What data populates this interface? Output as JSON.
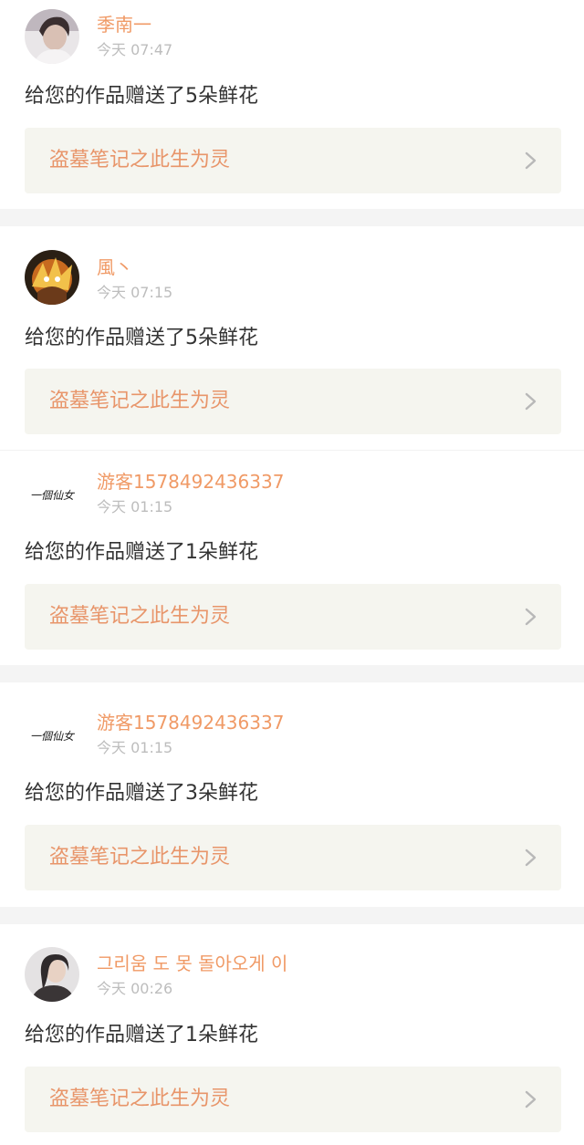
{
  "colors": {
    "accent": "#f09a66",
    "work_title": "#e8956a",
    "card_bg": "#f5f5ef",
    "muted": "#bdbdbd",
    "text": "#333333"
  },
  "notifications": [
    {
      "username": "季南一",
      "time": "今天 07:47",
      "message": "给您的作品赠送了5朵鲜花",
      "work_title": "盗墓笔记之此生为灵",
      "avatar_icon": "user-photo-icon"
    },
    {
      "username": "風丶",
      "time": "今天 07:15",
      "message": "给您的作品赠送了5朵鲜花",
      "work_title": "盗墓笔记之此生为灵",
      "avatar_icon": "anime-character-icon"
    },
    {
      "username": "游客1578492436337",
      "time": "今天 01:15",
      "message": "给您的作品赠送了1朵鲜花",
      "work_title": "盗墓笔记之此生为灵",
      "avatar_icon": "calligraphy-avatar-icon",
      "avatar_text": "一個仙女"
    },
    {
      "username": "游客1578492436337",
      "time": "今天 01:15",
      "message": "给您的作品赠送了3朵鲜花",
      "work_title": "盗墓笔记之此生为灵",
      "avatar_icon": "calligraphy-avatar-icon",
      "avatar_text": "一個仙女"
    },
    {
      "username": "그리움 도 못 돌아오게 이",
      "time": "今天 00:26",
      "message": "给您的作品赠送了1朵鲜花",
      "work_title": "盗墓笔记之此生为灵",
      "avatar_icon": "user-photo-icon"
    }
  ]
}
